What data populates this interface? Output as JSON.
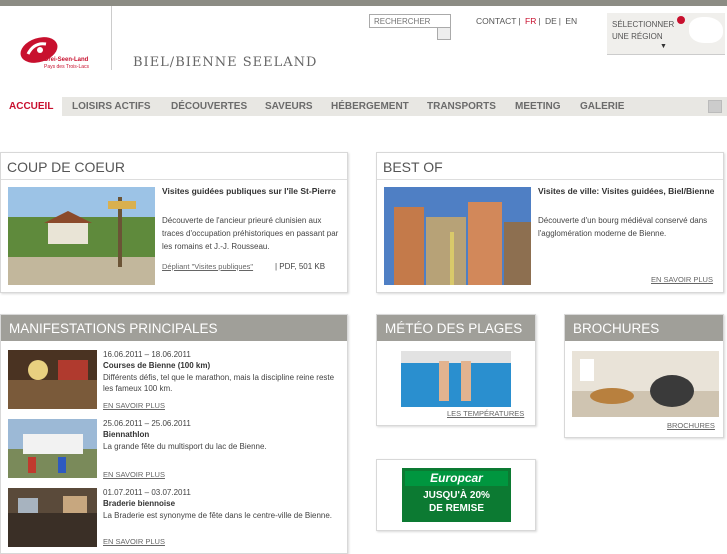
{
  "brand": {
    "logo_line1": "Drei-Seen-Land",
    "logo_line2": "Pays des Trois-Lacs",
    "site_title": "BIEL/BIENNE SEELAND"
  },
  "search": {
    "placeholder": "RECHERCHER"
  },
  "toplinks": {
    "contact": "CONTACT",
    "sep": "|",
    "fr": "FR",
    "de": "DE",
    "en": "EN"
  },
  "region": {
    "line1": "SÉLECTIONNER",
    "line2": "UNE RÉGION",
    "arrow": "▼"
  },
  "nav": {
    "items": [
      "ACCUEIL",
      "LOISIRS ACTIFS",
      "DÉCOUVERTES",
      "SAVEURS",
      "HÉBERGEMENT",
      "TRANSPORTS",
      "MEETING",
      "GALERIE"
    ]
  },
  "coup_de_coeur": {
    "heading": "COUP DE COEUR",
    "title": "Visites guidées publiques sur l'île St-Pierre",
    "text": "Découverte de l'ancieur prieuré clunisien aux traces d'occupation préhistoriques en passant par les romains et J.-J. Rousseau.",
    "link": "Dépliant \"Visites publiques\"",
    "file_info": "| PDF, 501 KB"
  },
  "best_of": {
    "heading": "BEST OF",
    "title": "Visites de ville: Visites guidées, Biel/Bienne",
    "text": "Découverte d'un bourg médiéval conservé dans l'agglomération moderne de Bienne.",
    "link": "EN SAVOIR PLUS"
  },
  "manifestations": {
    "heading": "MANIFESTATIONS PRINCIPALES",
    "events": [
      {
        "date": "16.06.2011 – 18.06.2011",
        "title": "Courses de Bienne (100 km)",
        "desc": "Différents défis, tel que le marathon, mais la discipline reine reste les fameux 100 km.",
        "link": "EN SAVOIR PLUS"
      },
      {
        "date": "25.06.2011 – 25.06.2011",
        "title": "Biennathlon",
        "desc": "La grande fête du multisport du lac de Bienne.",
        "link": "EN SAVOIR PLUS"
      },
      {
        "date": "01.07.2011 – 03.07.2011",
        "title": "Braderie biennoise",
        "desc": "La Braderie est synonyme de fête dans le centre-ville de Bienne.",
        "link": "EN SAVOIR PLUS"
      }
    ]
  },
  "meteo": {
    "heading": "MÉTÉO DES PLAGES",
    "link": "LES TEMPÉRATURES"
  },
  "brochures": {
    "heading": "BROCHURES",
    "link": "BROCHURES"
  },
  "ad": {
    "brand": "Europcar",
    "offer_line1": "JUSQU'À 20%",
    "offer_line2": "DE REMISE"
  }
}
